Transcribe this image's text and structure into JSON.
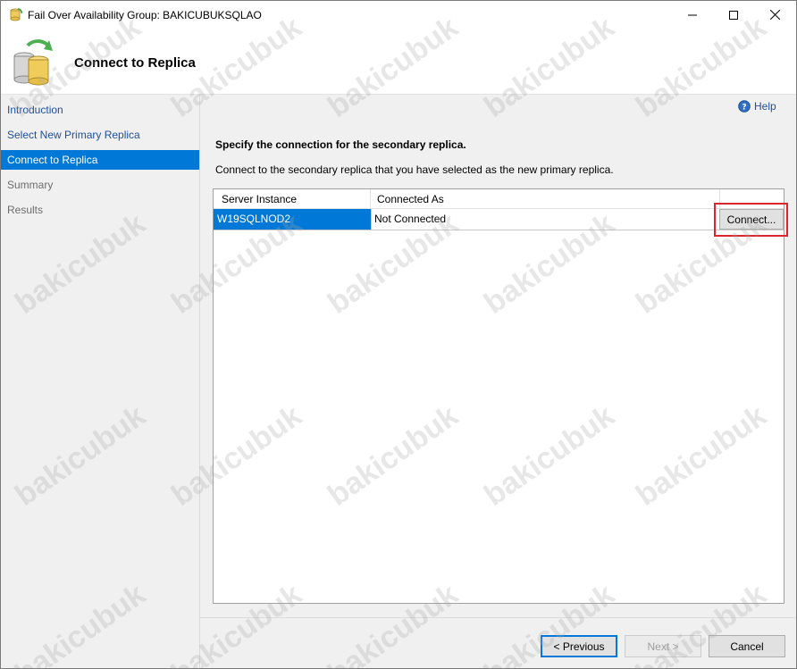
{
  "window": {
    "title": "Fail Over Availability Group: BAKICUBUKSQLAO",
    "controls": {
      "minimize": "minimize",
      "maximize": "maximize",
      "close": "close"
    }
  },
  "header": {
    "heading": "Connect to Replica",
    "icon": "database-failover-icon"
  },
  "sidebar": {
    "items": [
      {
        "label": "Introduction",
        "state": "link"
      },
      {
        "label": "Select New Primary Replica",
        "state": "link"
      },
      {
        "label": "Connect to Replica",
        "state": "active"
      },
      {
        "label": "Summary",
        "state": "disabled"
      },
      {
        "label": "Results",
        "state": "disabled"
      }
    ]
  },
  "main": {
    "help_label": "Help",
    "section_title": "Specify the connection for the secondary replica.",
    "section_description": "Connect to the secondary replica that you have selected as the new primary replica.",
    "grid": {
      "columns": [
        "Server Instance",
        "Connected As",
        ""
      ],
      "rows": [
        {
          "server_instance": "W19SQLNOD2",
          "connected_as": "Not Connected",
          "action": "Connect..."
        }
      ]
    }
  },
  "footer": {
    "previous": "< Previous",
    "next": "Next >",
    "cancel": "Cancel"
  },
  "watermark": "bakicubuk",
  "colors": {
    "accent": "#0078d7",
    "link": "#1e4f9e",
    "highlight": "#d9252c",
    "panel": "#f0f0f0"
  }
}
